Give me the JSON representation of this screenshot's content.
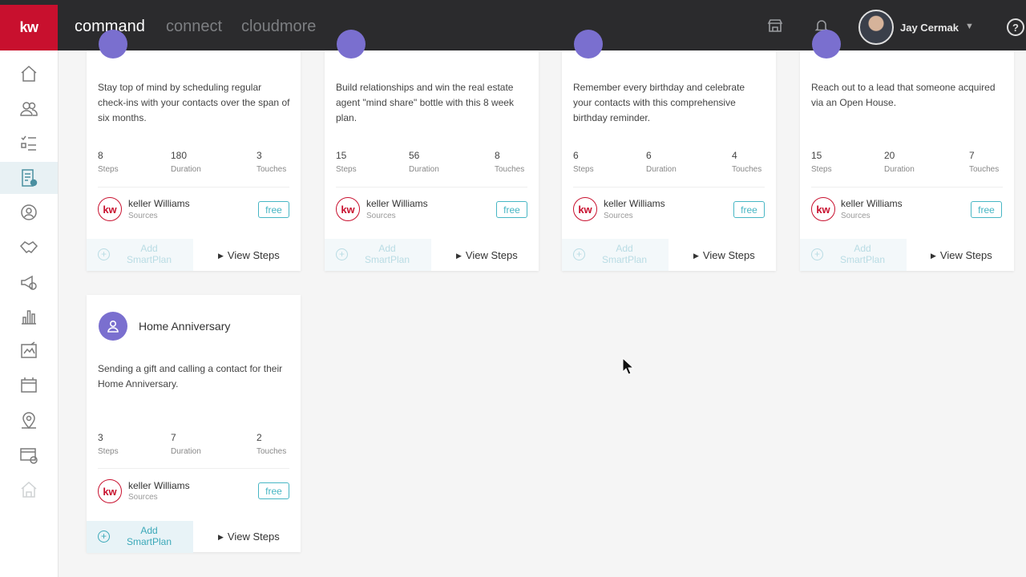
{
  "header": {
    "logo": "kw",
    "nav": [
      "command",
      "connect",
      "cloudmore"
    ],
    "user_name": "Jay Cermak",
    "help": "?"
  },
  "sidebar": {
    "icons": [
      "home-icon",
      "contacts-icon",
      "tasks-icon",
      "smartplans-icon",
      "opportunities-icon",
      "deals-icon",
      "marketing-icon",
      "reports-icon",
      "designs-icon",
      "listings-icon",
      "map-icon",
      "stores-icon",
      "house-icon"
    ]
  },
  "cards_top": [
    {
      "desc": "Stay top of mind by scheduling regular check-ins with your contacts over the span of six months.",
      "steps": "8",
      "duration": "180",
      "touches": "3"
    },
    {
      "desc": "Build relationships and win the real estate agent \"mind share\" bottle with this 8 week plan.",
      "steps": "15",
      "duration": "56",
      "touches": "8"
    },
    {
      "desc": "Remember every birthday and celebrate your contacts with this comprehensive birthday reminder.",
      "steps": "6",
      "duration": "6",
      "touches": "4"
    },
    {
      "desc": "Reach out to a lead that someone acquired via an Open House.",
      "steps": "15",
      "duration": "20",
      "touches": "7"
    }
  ],
  "card_bottom": {
    "title": "Home Anniversary",
    "desc": "Sending a gift and calling a contact for their Home Anniversary.",
    "steps": "3",
    "duration": "7",
    "touches": "2"
  },
  "labels": {
    "steps": "Steps",
    "duration": "Duration",
    "touches": "Touches",
    "source_logo": "kw",
    "source_name": "keller Williams",
    "source_sub": "Sources",
    "free": "free",
    "add_smartplan": "Add SmartPlan",
    "view_steps": "View Steps"
  },
  "colors": {
    "brand_red": "#c8102e",
    "accent_teal": "#47b6c4",
    "plan_purple": "#7a6fcf",
    "topbar": "#2b2b2d"
  }
}
